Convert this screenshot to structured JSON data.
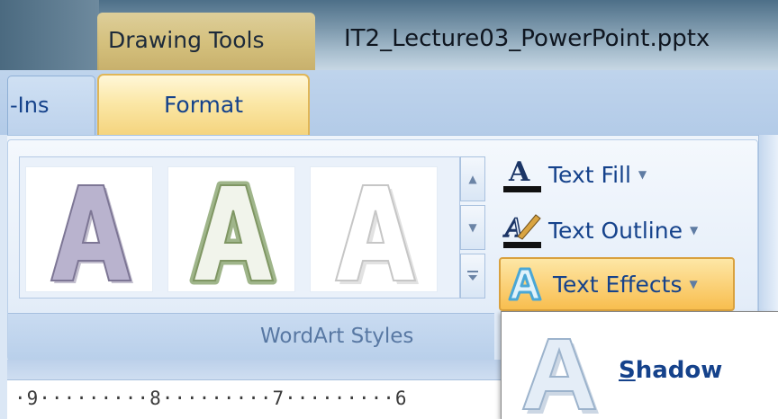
{
  "titlebar": {
    "context_label": "Drawing Tools",
    "document_title": "IT2_Lecture03_PowerPoint.pptx"
  },
  "tabs": [
    {
      "label": "-Ins",
      "active": false
    },
    {
      "label": "Format",
      "active": true
    }
  ],
  "wordart_group": {
    "label": "WordArt Styles",
    "gallery": [
      {
        "glyph": "A",
        "style": "purple-shadow",
        "fill": "#b7b1cc",
        "stroke": "#7d7695"
      },
      {
        "glyph": "A",
        "style": "green-outline",
        "fill": "#eef2e6",
        "stroke": "#8aa26e"
      },
      {
        "glyph": "A",
        "style": "white-shadow",
        "fill": "#ffffff",
        "stroke": "#c9c9c9"
      }
    ],
    "gallery_scroll": [
      "scroll-up",
      "scroll-down",
      "more"
    ],
    "commands": [
      {
        "label": "Text Fill",
        "icon": "text-fill-icon",
        "has_dropdown": true
      },
      {
        "label": "Text Outline",
        "icon": "text-outline-icon",
        "has_dropdown": true
      },
      {
        "label": "Text Effects",
        "icon": "text-effects-icon",
        "has_dropdown": true,
        "active": true
      }
    ]
  },
  "ruler": {
    "text": "·9·········8·········7·········6"
  },
  "text_effects_menu": {
    "items": [
      {
        "label_underlined": "S",
        "label_rest": "hadow",
        "icon": "shadow-effect-icon"
      }
    ]
  },
  "colors": {
    "ribbon_blue": "#dbe7f5",
    "tab_active": "#fbe7a6",
    "label_blue": "#15428b",
    "highlight_orange": "#f8be4f"
  }
}
